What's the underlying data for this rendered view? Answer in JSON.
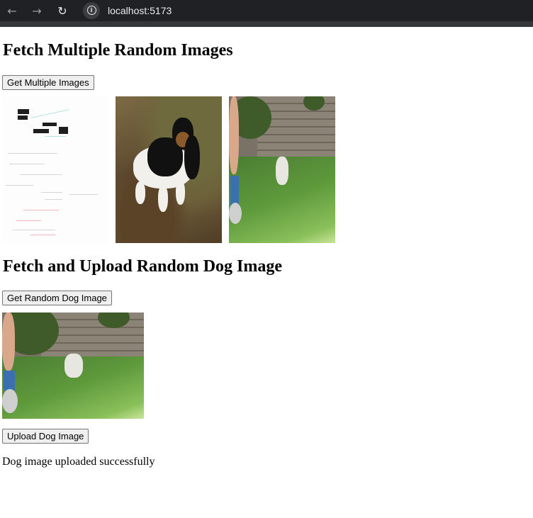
{
  "browser": {
    "url": "localhost:5173",
    "icons": [
      "arrow-back-icon",
      "arrow-forward-icon",
      "reload-icon",
      "info-icon"
    ]
  },
  "section_multiple": {
    "heading": "Fetch Multiple Random Images",
    "button_label": "Get Multiple Images",
    "images": [
      {
        "alt": "diagram image"
      },
      {
        "alt": "basset hound puppy"
      },
      {
        "alt": "dog in backyard"
      }
    ]
  },
  "section_dog": {
    "heading": "Fetch and Upload Random Dog Image",
    "get_button_label": "Get Random Dog Image",
    "upload_button_label": "Upload Dog Image",
    "status_text": "Dog image uploaded successfully"
  }
}
